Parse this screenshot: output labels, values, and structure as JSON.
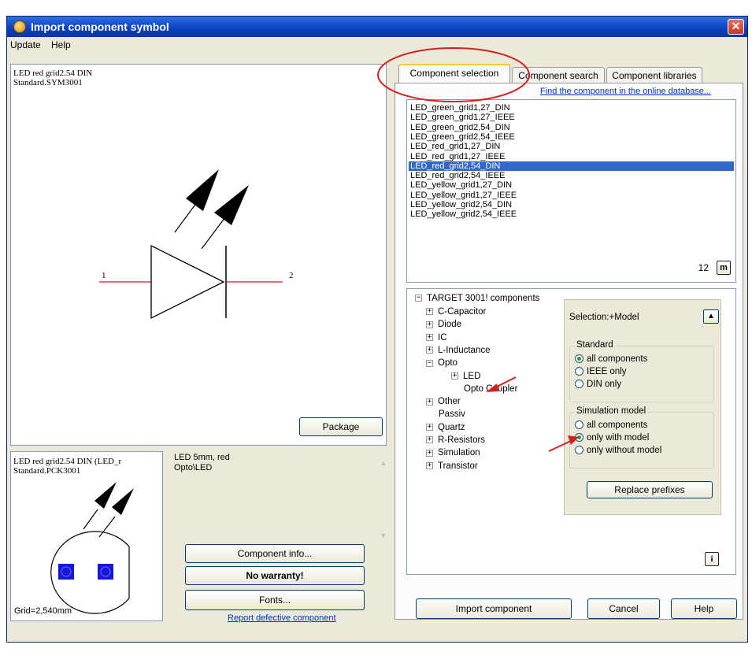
{
  "window": {
    "title": "Import component symbol",
    "close_glyph": "✕"
  },
  "menu": {
    "items": [
      "Update",
      "Help"
    ]
  },
  "symbol_preview": {
    "name_line": "LED red grid2.54 DIN",
    "library_line": "Standard.SYM3001",
    "pin1": "1",
    "pin2": "2",
    "package_button": "Package",
    "icon": "led-diode-symbol"
  },
  "package_preview": {
    "name_line": "LED red grid2.54 DIN (LED_r",
    "library_line": "Standard.PCK3001",
    "grid_label": "Grid=2,540mm",
    "description_line1": "LED 5mm, red",
    "description_line2": "Opto\\LED"
  },
  "actions": {
    "component_info": "Component info...",
    "no_warranty": "No warranty!",
    "fonts": "Fonts...",
    "report_link": "Report defective component"
  },
  "tabs": [
    "Component selection",
    "Component search",
    "Component libraries"
  ],
  "online_db_link": "Find the component in the online database...",
  "component_list": {
    "items": [
      "LED_green_grid1,27_DIN",
      "LED_green_grid1,27_IEEE",
      "LED_green_grid2,54_DIN",
      "LED_green_grid2,54_IEEE",
      "LED_red_grid1,27_DIN",
      "LED_red_grid1,27_IEEE",
      "LED_red_grid2,54_DIN",
      "LED_red_grid2,54_IEEE",
      "LED_yellow_grid1,27_DIN",
      "LED_yellow_grid1,27_IEEE",
      "LED_yellow_grid2,54_DIN",
      "LED_yellow_grid2,54_IEEE"
    ],
    "selected_index": 6,
    "count": "12",
    "m_button": "m"
  },
  "tree": {
    "root": "TARGET 3001! components",
    "items": [
      {
        "label": "C-Capacitor",
        "toggle": "+"
      },
      {
        "label": "Diode",
        "toggle": "+"
      },
      {
        "label": "IC",
        "toggle": "+"
      },
      {
        "label": "L-Inductance",
        "toggle": "+"
      },
      {
        "label": "Opto",
        "toggle": "−"
      },
      {
        "label": "LED",
        "toggle": "+"
      },
      {
        "label": "Opto Coupler",
        "toggle": ""
      },
      {
        "label": "Other",
        "toggle": "+"
      },
      {
        "label": "Passiv",
        "toggle": ""
      },
      {
        "label": "Quartz",
        "toggle": "+"
      },
      {
        "label": "R-Resistors",
        "toggle": "+"
      },
      {
        "label": "Simulation",
        "toggle": "+"
      },
      {
        "label": "Transistor",
        "toggle": "+"
      }
    ],
    "info_button": "i"
  },
  "selection_panel": {
    "title": "Selection:+Model",
    "collapse_glyph": "▲",
    "standard": {
      "legend": "Standard",
      "options": [
        "all components",
        "IEEE only",
        "DIN only"
      ],
      "selected": 0
    },
    "simulation": {
      "legend": "Simulation model",
      "options": [
        "all components",
        "only with model",
        "only without model"
      ],
      "selected": 1
    },
    "replace_prefixes": "Replace prefixes"
  },
  "footer": {
    "import": "Import component",
    "cancel": "Cancel",
    "help": "Help"
  },
  "colors": {
    "annotation_red": "#d42020",
    "pad_blue": "#1717d6",
    "selection_blue": "#316ac5",
    "symbol_line": "#c82828"
  }
}
